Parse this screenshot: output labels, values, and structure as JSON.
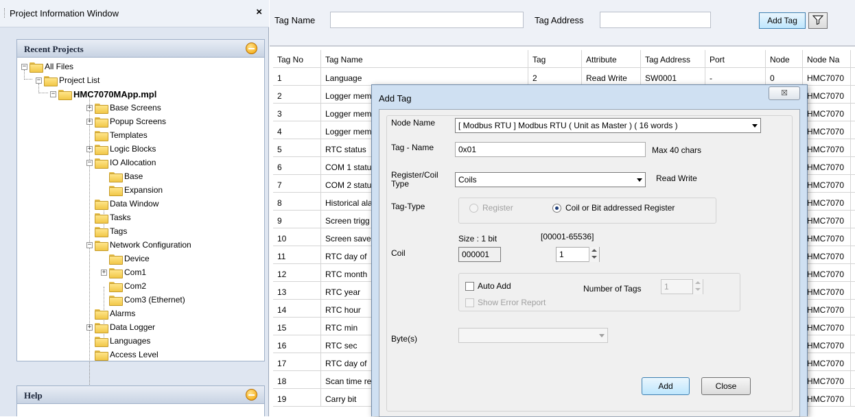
{
  "left_panel": {
    "title": "Project Information Window",
    "close_glyph": "×",
    "recent_title": "Recent Projects",
    "help_title": "Help",
    "tree": [
      {
        "label": "All Files"
      },
      {
        "label": "Project List"
      },
      {
        "label": "HMC7070MApp.mpl"
      },
      {
        "label": "Base Screens"
      },
      {
        "label": "Popup Screens"
      },
      {
        "label": "Templates"
      },
      {
        "label": "Logic Blocks"
      },
      {
        "label": "IO Allocation"
      },
      {
        "label": "Base"
      },
      {
        "label": "Expansion"
      },
      {
        "label": "Data Window"
      },
      {
        "label": "Tasks"
      },
      {
        "label": "Tags"
      },
      {
        "label": "Network Configuration"
      },
      {
        "label": "Device"
      },
      {
        "label": "Com1"
      },
      {
        "label": "Com2"
      },
      {
        "label": "Com3 (Ethernet)"
      },
      {
        "label": "Alarms"
      },
      {
        "label": "Data Logger"
      },
      {
        "label": "Languages"
      },
      {
        "label": "Access Level"
      }
    ]
  },
  "filter_bar": {
    "tag_name_label": "Tag Name",
    "tag_name_value": "",
    "tag_address_label": "Tag Address",
    "tag_address_value": "",
    "add_tag_label": "Add Tag"
  },
  "table": {
    "headers": [
      "Tag No",
      "Tag Name",
      "Tag",
      "Attribute",
      "Tag Address",
      "Port",
      "Node",
      "Node Na"
    ],
    "rows": [
      [
        "1",
        "Language",
        "2",
        "Read Write",
        "SW0001",
        "-",
        "0",
        "HMC7070"
      ],
      [
        "2",
        "Logger mem",
        "",
        "",
        "",
        "",
        "",
        "HMC7070"
      ],
      [
        "3",
        "Logger mem",
        "",
        "",
        "",
        "",
        "",
        "HMC7070"
      ],
      [
        "4",
        "Logger mem",
        "",
        "",
        "",
        "",
        "",
        "HMC7070"
      ],
      [
        "5",
        "RTC status",
        "",
        "",
        "",
        "",
        "",
        "HMC7070"
      ],
      [
        "6",
        "COM 1 statu",
        "",
        "",
        "",
        "",
        "",
        "HMC7070"
      ],
      [
        "7",
        "COM 2 statu",
        "",
        "",
        "",
        "",
        "",
        "HMC7070"
      ],
      [
        "8",
        "Historical ala",
        "",
        "",
        "",
        "",
        "",
        "HMC7070"
      ],
      [
        "9",
        "Screen trigg",
        "",
        "",
        "",
        "",
        "",
        "HMC7070"
      ],
      [
        "10",
        "Screen save",
        "",
        "",
        "",
        "",
        "",
        "HMC7070"
      ],
      [
        "11",
        "RTC day of",
        "",
        "",
        "",
        "",
        "",
        "HMC7070"
      ],
      [
        "12",
        "RTC month",
        "",
        "",
        "",
        "",
        "",
        "HMC7070"
      ],
      [
        "13",
        "RTC year",
        "",
        "",
        "",
        "",
        "",
        "HMC7070"
      ],
      [
        "14",
        "RTC hour",
        "",
        "",
        "",
        "",
        "",
        "HMC7070"
      ],
      [
        "15",
        "RTC min",
        "",
        "",
        "",
        "",
        "",
        "HMC7070"
      ],
      [
        "16",
        "RTC sec",
        "",
        "",
        "",
        "",
        "",
        "HMC7070"
      ],
      [
        "17",
        "RTC day of",
        "",
        "",
        "",
        "",
        "",
        "HMC7070"
      ],
      [
        "18",
        "Scan time re",
        "",
        "",
        "",
        "",
        "",
        "HMC7070"
      ],
      [
        "19",
        "Carry bit",
        "",
        "",
        "",
        "",
        "",
        "HMC7070"
      ]
    ]
  },
  "dialog": {
    "title": "Add Tag",
    "close_glyph": "☒",
    "node_name_label": "Node Name",
    "node_name_value": "[ Modbus RTU ] Modbus RTU ( Unit as Master ) ( 16 words )",
    "tag_name_label": "Tag - Name",
    "tag_name_value": "0x01",
    "max_chars_note": "Max 40 chars",
    "register_type_label": "Register/Coil\nType",
    "register_type_value": "Coils",
    "access_note": "Read Write",
    "tag_type_label": "Tag-Type",
    "radio_register": "Register",
    "radio_coil": "Coil or Bit addressed Register",
    "size_label": "Size : 1 bit",
    "range_label": "[00001-65536]",
    "coil_label": "Coil",
    "coil_address": "000001",
    "coil_spin_value": "1",
    "auto_add_label": "Auto Add",
    "number_of_tags_label": "Number of Tags",
    "number_of_tags_value": "1",
    "show_error_label": "Show Error Report",
    "bytes_label": "Byte(s)",
    "add_button": "Add",
    "close_button": "Close"
  }
}
